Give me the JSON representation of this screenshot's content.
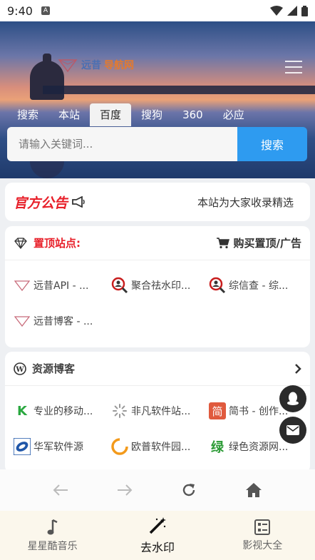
{
  "status_bar": {
    "time": "9:40",
    "indicator": "A"
  },
  "header": {
    "logo_part1": "远昔",
    "logo_part2": "导航网",
    "search_tabs": [
      "搜索",
      "本站",
      "百度",
      "搜狗",
      "360",
      "必应"
    ],
    "active_tab_index": 2,
    "search_placeholder": "请输入关键词...",
    "search_button": "搜索"
  },
  "notice": {
    "title": "官方公告",
    "text": "本站为大家收录精选"
  },
  "pinned": {
    "title": "置顶站点:",
    "action": "购买置顶/广告",
    "sites": [
      "远昔API - ...",
      "聚合祛水印...",
      "综信查 - 综...",
      "远昔博客 - ..."
    ]
  },
  "blog": {
    "title": "资源博客",
    "sites": [
      {
        "label": "专业的移动...",
        "glyph": "K"
      },
      {
        "label": "非凡软件站...",
        "glyph": ""
      },
      {
        "label": "简书 - 创作...",
        "glyph": "简"
      },
      {
        "label": "华军软件源",
        "glyph": ""
      },
      {
        "label": "欧普软件园...",
        "glyph": ""
      },
      {
        "label": "绿色资源网...",
        "glyph": "绿"
      }
    ]
  },
  "bottom_nav": [
    "星星酷音乐",
    "去水印",
    "影视大全"
  ],
  "colors": {
    "accent": "#2e9bf0",
    "notice_red": "#e8202a",
    "nav_bg": "#fbf7ec"
  }
}
